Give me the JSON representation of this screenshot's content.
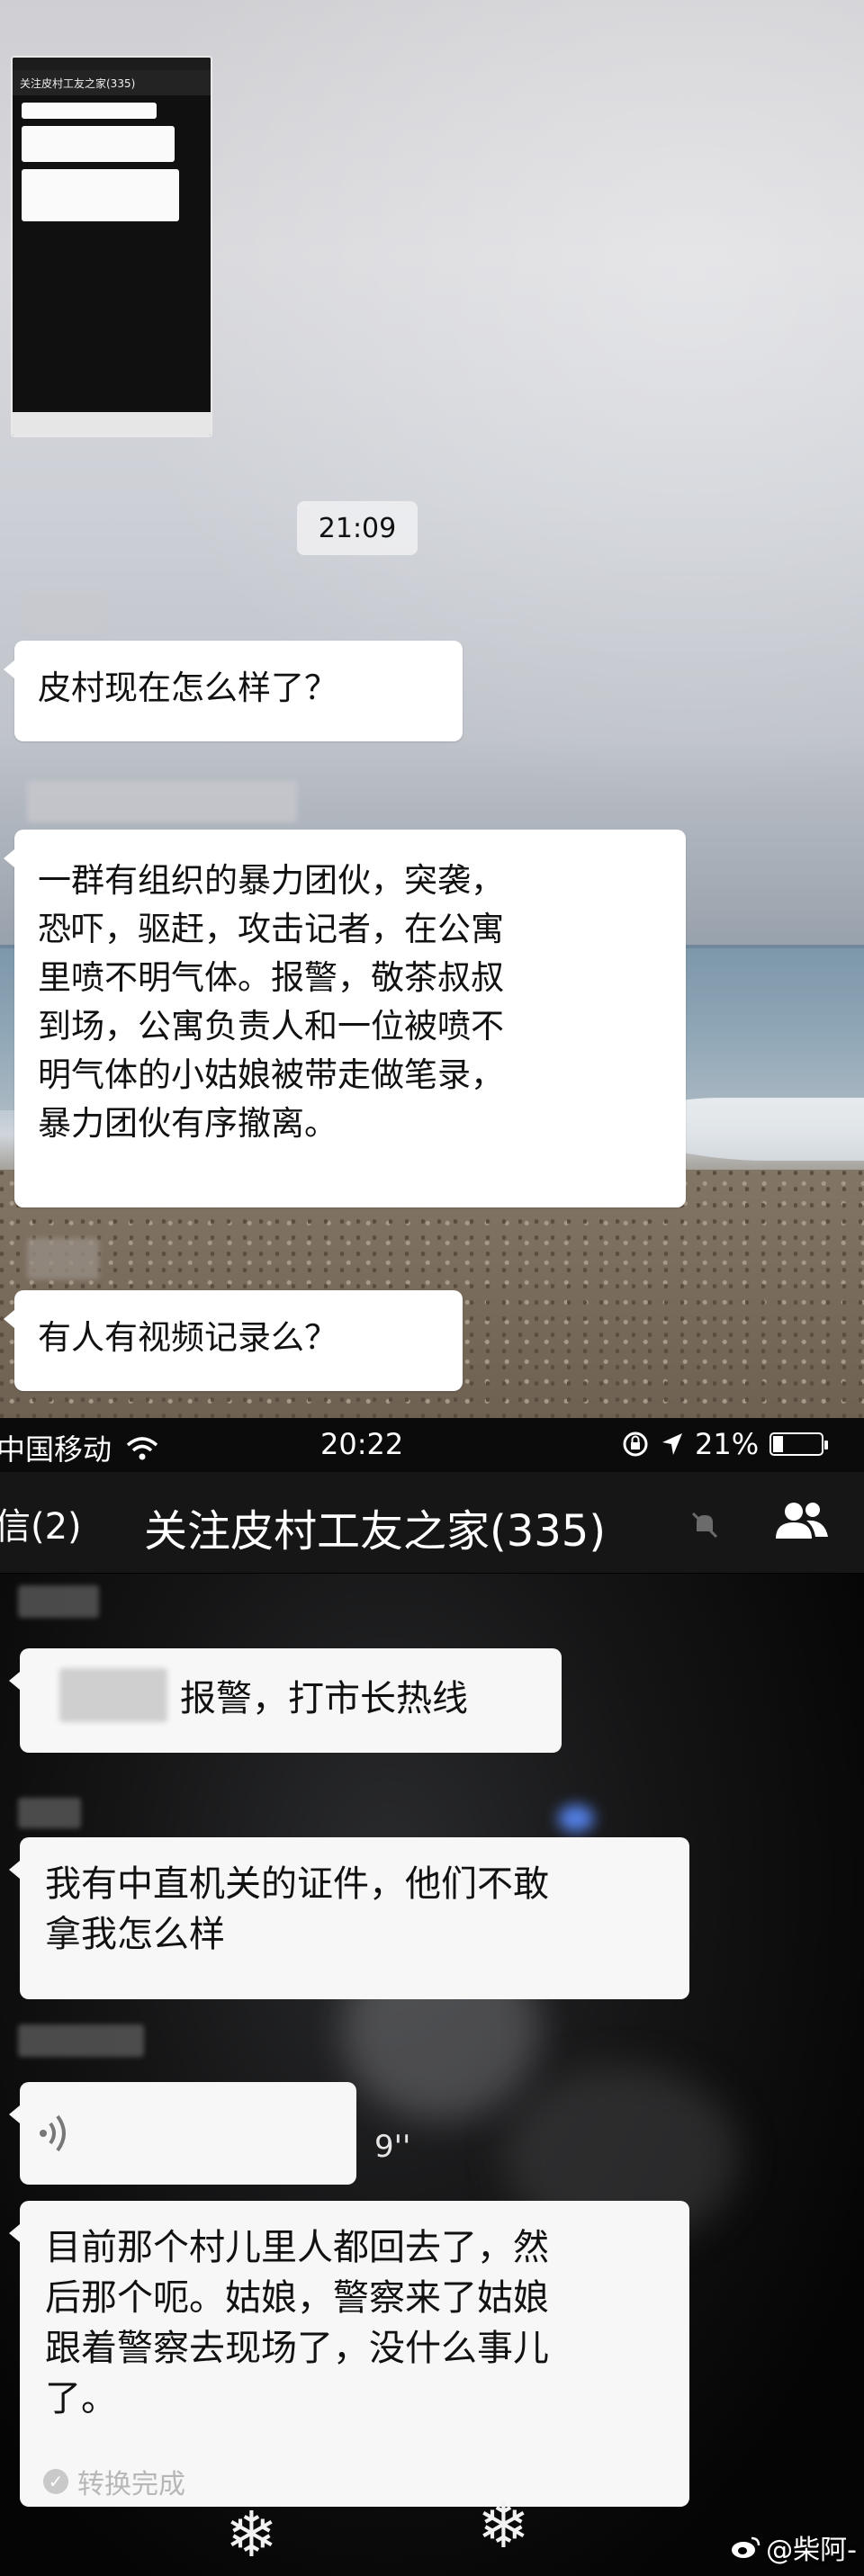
{
  "top_screen": {
    "thumbnail": {
      "title": "关注皮村工友之家(335)"
    },
    "timestamp": "21:09",
    "messages": [
      {
        "text": "皮村现在怎么样了？"
      },
      {
        "text": "一群有组织的暴力团伙，突袭，\n恐吓，驱赶，攻击记者，在公寓\n里喷不明气体。报警，敬茶叔叔\n到场，公寓负责人和一位被喷不\n明气体的小姑娘被带走做笔录，\n暴力团伙有序撤离。"
      },
      {
        "text": "有人有视频记录么？"
      }
    ]
  },
  "bottom_screen": {
    "status_bar": {
      "carrier": "中国移动",
      "time": "20:22",
      "battery": "21%",
      "battery_level": 0.21
    },
    "nav": {
      "back_label": "信(2)",
      "title": "关注皮村工友之家(335)"
    },
    "messages": [
      {
        "text": "报警，打市长热线"
      },
      {
        "text": "我有中直机关的证件，他们不敢\n拿我怎么样"
      },
      {
        "voice_duration": "9''"
      },
      {
        "text": "目前那个村儿里人都回去了，然\n后那个呃。姑娘，警察来了姑娘\n跟着警察去现场了，没什么事儿\n了。"
      }
    ],
    "convert_status": "转换完成"
  },
  "watermark": "@柴阿-",
  "icons": [
    "wifi-icon",
    "location-arrow-icon",
    "rotation-lock-icon",
    "battery-icon",
    "mute-icon",
    "group-members-icon",
    "voice-icon",
    "check-icon",
    "weibo-icon"
  ]
}
